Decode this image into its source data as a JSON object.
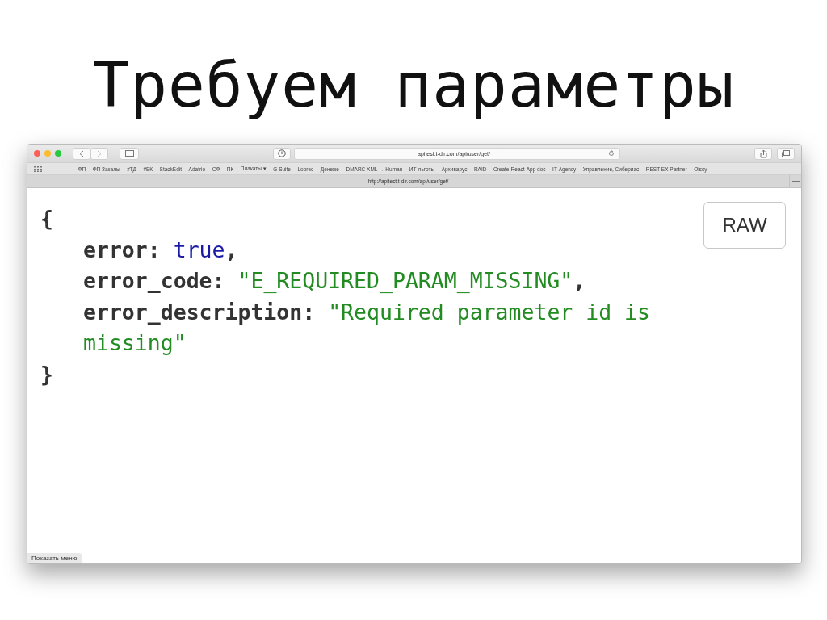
{
  "slide_title": "Требуем параметры",
  "browser": {
    "address": "apitest.t-dir.com/api/user/get/",
    "bookmarks": [
      "ФП",
      "ФП Закалы",
      "#ТД",
      "#БК",
      "StackEdit",
      "Adatrio",
      "СФ",
      "ПК",
      "Плакаты ▾",
      "G Suite",
      "Loorec",
      "Денеже",
      "DMARC XML → Human",
      "ИТ-льготы",
      "Архиварус",
      "RAID",
      "Create-React-App doc",
      "IT-Agency",
      "Управление, Сибериас",
      "REST EX Partner",
      "Oiscy"
    ],
    "tab_title": "http://apitest.t-dir.com/api/user/get/",
    "raw_button": "RAW",
    "status_text": "Показать меню"
  },
  "json_view": [
    {
      "tokens": [
        {
          "kind": "punct",
          "text": "{"
        }
      ],
      "children": [
        {
          "tokens": [
            {
              "kind": "key",
              "text": "error:"
            },
            {
              "kind": "bool",
              "text": "true"
            },
            {
              "kind": "punct",
              "text": ","
            }
          ]
        },
        {
          "tokens": [
            {
              "kind": "key",
              "text": "error_code:"
            },
            {
              "kind": "string",
              "text": "\"E_REQUIRED_PARAM_MISSING\""
            },
            {
              "kind": "punct",
              "text": ","
            }
          ]
        },
        {
          "tokens": [
            {
              "kind": "key",
              "text": "error_description:"
            },
            {
              "kind": "string",
              "text": "\"Required parameter id is missing\""
            }
          ]
        }
      ]
    },
    {
      "tokens": [
        {
          "kind": "punct",
          "text": "}"
        }
      ]
    }
  ]
}
